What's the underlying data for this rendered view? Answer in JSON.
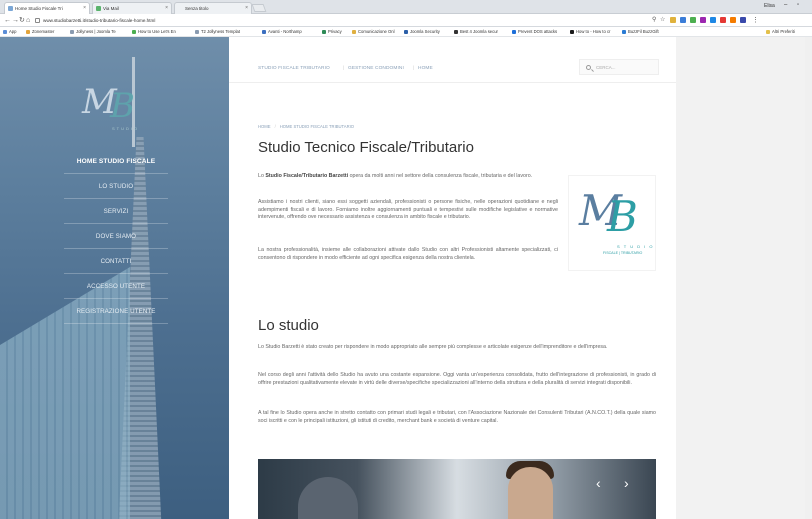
{
  "browser": {
    "tabs": [
      {
        "label": "Home Studio Fiscale Tri"
      },
      {
        "label": "Via Mail"
      },
      {
        "label": "Senza titolo"
      }
    ],
    "user": "Elisa",
    "url": "www.studiobarzetti.it/studio-tributario-fiscale-home.html",
    "bookmarks": [
      {
        "label": "App",
        "color": "#5b8dd6"
      },
      {
        "label": "Zonemaster",
        "color": "#e3a43b"
      },
      {
        "label": "Jollyness | Joomla Te",
        "color": "#8a9bb0"
      },
      {
        "label": "How to Use Let's En",
        "color": "#4caf50"
      },
      {
        "label": "T2 Jollyness Templat",
        "color": "#8a9bb0"
      },
      {
        "label": "Avanti - Northamp",
        "color": "#3b6fc0"
      },
      {
        "label": "Privacy",
        "color": "#2e8b57"
      },
      {
        "label": "Comunicazione Onl",
        "color": "#e0b040"
      },
      {
        "label": "Joomla Security",
        "color": "#2b5fa8"
      },
      {
        "label": "Best 4 Joomla secur",
        "color": "#333333"
      },
      {
        "label": "Prevent DOS attacks",
        "color": "#1e6fd9"
      },
      {
        "label": "How to - How to cr",
        "color": "#1a1a1a"
      },
      {
        "label": "BuzzFil BuzzGift",
        "color": "#2a7bd4"
      },
      {
        "label": "Altri Preferiti",
        "color": "#e3c04a"
      }
    ]
  },
  "sidebar": {
    "logo_sub": "STUDIO",
    "items": [
      {
        "label": "HOME STUDIO FISCALE"
      },
      {
        "label": "LO STUDIO"
      },
      {
        "label": "SERVIZI"
      },
      {
        "label": "DOVE SIAMO"
      },
      {
        "label": "CONTATTI"
      },
      {
        "label": "ACCESSO UTENTE"
      },
      {
        "label": "REGISTRAZIONE UTENTE"
      }
    ]
  },
  "topnav": {
    "items": [
      "STUDIO FISCALE TRIBUTARIO",
      "GESTIONE CONDOMINI",
      "HOME"
    ],
    "search_placeholder": "CERCA..."
  },
  "breadcrumb": {
    "home": "HOME",
    "current": "HOME STUDIO FISCALE TRIBUTARIO"
  },
  "main": {
    "title": "Studio Tecnico Fiscale/Tributario",
    "intro_pre": "Lo ",
    "intro_bold": "Studio Fiscale/Tributario Barzetti",
    "intro_post": " opera da molti anni nel settore della consulenza fiscale, tributaria e del lavoro.",
    "para2": "Assistiamo i nostri clienti, siano essi soggetti aziendali, professionisti o persone fisiche, nelle operazioni quotidiane e negli adempimenti fiscali e di lavoro. Forniamo inoltre aggiornamenti puntuali e tempestivi sulle modifiche legislative e normative intervenute, offrendo ove necessario assistenza e consulenza in ambito fiscale e tributario.",
    "para3": "La nostra professionalità, insieme alle collaborazioni attivate dallo Studio con altri Professionisti altamente specializzati, ci consentono di rispondere in modo efficiente ad ogni specifica esigenza della nostra clientela.",
    "logo_studio": "S T U D I O",
    "logo_caption": "FISCALE | TRIBUTARIO",
    "section2_title": "Lo studio",
    "s2p1": "Lo Studio Barzetti è stato creato per rispondere in modo appropriato alle sempre più complesse e articolate esigenze dell'imprenditore e dell'impresa.",
    "s2p2": "Nel corso degli anni l'attività dello Studio ha avuto una costante espansione. Oggi vanta un'esperienza consolidata, frutto dell'integrazione di professionisti, in grado di offrire prestazioni qualitativamente elevate in virtù delle diverse/specifiche specializzazioni all'interno della struttura e della pluralità di servizi integrati disponibili.",
    "s2p3": "A tal fine lo Studio opera anche in stretto contatto con primari studi legali e tributari, con l'Associazione Nazionale dei Consulenti Tributari (A.N.CO.T.) della quale siamo soci iscritti e con le principali istituzioni, gli istituti di credito, merchant bank e società di venture capital."
  }
}
